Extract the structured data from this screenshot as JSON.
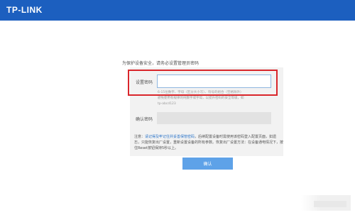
{
  "header": {
    "logo_text": "TP-LINK"
  },
  "form": {
    "intro": "为保护设备安全，请务必设置管理员密码",
    "set_password_label": "设置密码",
    "password_value": "",
    "hint_lines": [
      "6-15位数字、字母（区分大小写）、符号的组合（空格除外）",
      "避免使用有规律的纯数字或字母，以提升密码的安全等级，如",
      "tp-abcd123"
    ],
    "confirm_password_label": "确认密码",
    "confirm_value": "",
    "note_prefix": "注意：",
    "note_link": "请记得及牢记住并妥善保管密码",
    "note_rest": "，后续配置设备时需使用该密码登入配置页面，如遗忘，只能恢复出厂设置，重新设置设备的所有参数。恢复出厂设置方法：在设备通电情况下，按住Reset按钮保持5秒以上。",
    "confirm_button": "确认"
  },
  "colors": {
    "topbar": "#1c5fbf",
    "highlight_border": "#d9262b",
    "button": "#5ea2e8",
    "link": "#2b74c8"
  }
}
